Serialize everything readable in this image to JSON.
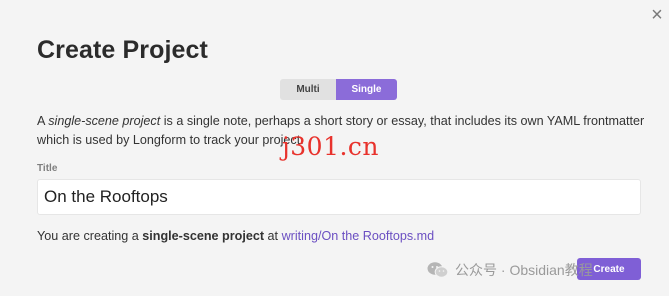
{
  "dialog": {
    "title": "Create Project",
    "close_glyph": "×"
  },
  "mode_toggle": {
    "options": [
      "Multi",
      "Single"
    ],
    "selected": "Single"
  },
  "description": {
    "prefix": "A ",
    "emphasis": "single-scene project",
    "suffix": " is a single note, perhaps a short story or essay, that includes its own YAML frontmatter which is used by Longform to track your project."
  },
  "title_field": {
    "label": "Title",
    "value": "On the Rooftops"
  },
  "path_line": {
    "prefix": "You are creating a ",
    "project_type": "single-scene project",
    "middle": " at ",
    "path": "writing/On the Rooftops.md"
  },
  "create_button": {
    "label": "Create"
  },
  "overlays": {
    "watermark": "j301.cn",
    "wechat_text": "公众号 · Obsidian教程"
  },
  "colors": {
    "accent": "#8b6cd9",
    "link": "#6b4fc2",
    "watermark": "#e8322c"
  }
}
